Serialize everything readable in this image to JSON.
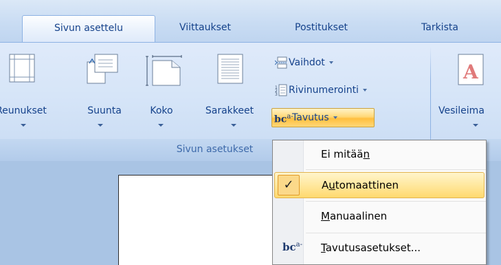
{
  "tabs": [
    "Sivun asettelu",
    "Viittaukset",
    "Postitukset",
    "Tarkista"
  ],
  "ribbon": {
    "page_setup": {
      "label": "Sivun asetukset",
      "margins": "Reunukset",
      "orientation": "Suunta",
      "size": "Koko",
      "columns": "Sarakkeet",
      "breaks": "Vaihdot",
      "line_numbers": "Rivinumerointi",
      "hyphenation": "Tavutus"
    },
    "background": {
      "watermark": "Vesileima"
    }
  },
  "hyphen_icon_text": "bc",
  "hyphen_icon_sup": "a-",
  "menu": {
    "none_pre": "Ei mitää",
    "none_u": "n",
    "auto_pre": "A",
    "auto_u": "u",
    "auto_post": "tomaattinen",
    "check": "✓",
    "manual_u": "M",
    "manual_post": "anuaalinen",
    "options_u": "T",
    "options_post": "avutusasetukset..."
  },
  "colors": {
    "ribbon_text": "#15428b",
    "highlight": "#ffd877",
    "workspace": "#a9c4e4"
  }
}
